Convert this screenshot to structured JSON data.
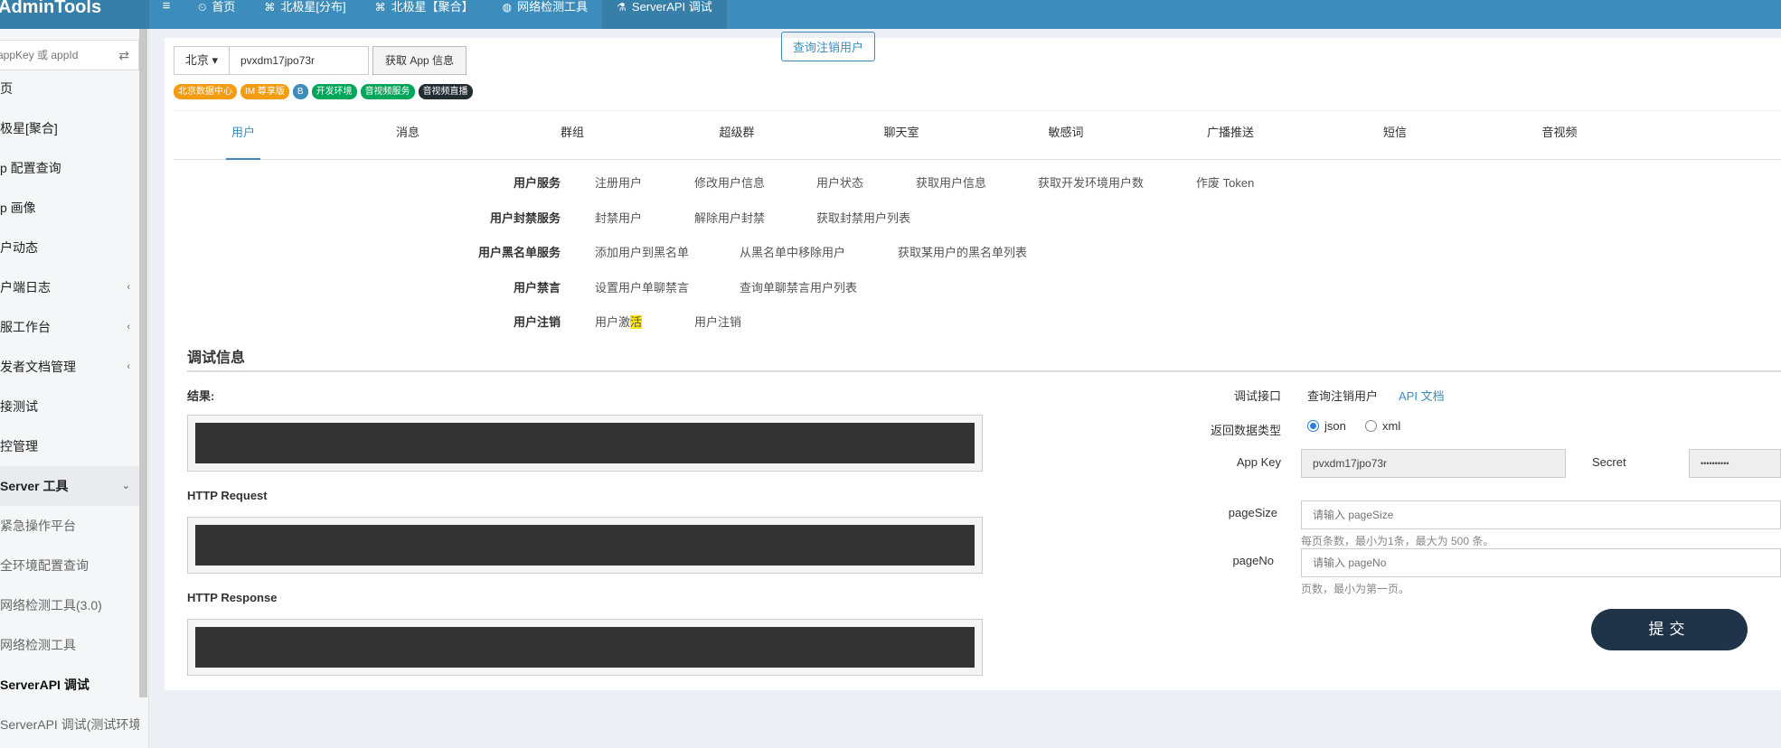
{
  "app": {
    "logo": "AdminTools"
  },
  "nav": {
    "toggle": "≡",
    "items": [
      {
        "icon": "⏲",
        "label": "首页"
      },
      {
        "icon": "⌘",
        "label": "北极星[分布]"
      },
      {
        "icon": "⌘",
        "label": "北极星【聚合】"
      },
      {
        "icon": "◍",
        "label": "网络检测工具"
      },
      {
        "icon": "⚗",
        "label": "ServerAPI 调试"
      }
    ]
  },
  "sidebar": {
    "search_placeholder": "appKey 或 appId",
    "switch_icon": "⇄",
    "items": [
      {
        "label": "页",
        "caret": "",
        "style": ""
      },
      {
        "label": "极星[聚合]",
        "caret": "",
        "style": ""
      },
      {
        "label": "p 配置查询",
        "caret": "",
        "style": ""
      },
      {
        "label": "p 画像",
        "caret": "",
        "style": ""
      },
      {
        "label": "户动态",
        "caret": "",
        "style": ""
      },
      {
        "label": "户端日志",
        "caret": "‹",
        "style": ""
      },
      {
        "label": "服工作台",
        "caret": "‹",
        "style": ""
      },
      {
        "label": "发者文档管理",
        "caret": "‹",
        "style": ""
      },
      {
        "label": "接测试",
        "caret": "",
        "style": ""
      },
      {
        "label": "控管理",
        "caret": "",
        "style": ""
      },
      {
        "label": "Server 工具",
        "caret": "⌄",
        "style": "bold"
      },
      {
        "label": "紧急操作平台",
        "caret": "",
        "style": "sub"
      },
      {
        "label": "全环境配置查询",
        "caret": "",
        "style": "sub"
      },
      {
        "label": "网络检测工具(3.0)",
        "caret": "",
        "style": "sub"
      },
      {
        "label": "网络检测工具",
        "caret": "",
        "style": "sub"
      },
      {
        "label": "ServerAPI 调试",
        "caret": "",
        "style": "sub active"
      },
      {
        "label": "ServerAPI 调试(测试环境)",
        "caret": "",
        "style": "sub"
      }
    ]
  },
  "toolbar": {
    "region": "北京 ▾",
    "appkey": "pvxdm17jpo73r",
    "fetch_label": "获取 App 信息"
  },
  "badges": [
    {
      "label": "北京数据中心",
      "color": "#f39c12"
    },
    {
      "label": "IM 尊享版",
      "color": "#f39c12"
    },
    {
      "label": "B",
      "color": "#3c8dbc"
    },
    {
      "label": "开发环境",
      "color": "#00a65a"
    },
    {
      "label": "音视频服务",
      "color": "#00a65a"
    },
    {
      "label": "音视频直播",
      "color": "#222d32"
    }
  ],
  "tabs": [
    "用户",
    "消息",
    "群组",
    "超级群",
    "聊天室",
    "敏感词",
    "广播推送",
    "短信",
    "音视频"
  ],
  "services": [
    {
      "label": "用户服务",
      "links": [
        "注册用户",
        "修改用户信息",
        "用户状态",
        "获取用户信息",
        "获取开发环境用户数",
        "作废 Token"
      ]
    },
    {
      "label": "用户封禁服务",
      "links": [
        "封禁用户",
        "解除用户封禁",
        "获取封禁用户列表"
      ]
    },
    {
      "label": "用户黑名单服务",
      "links": [
        "添加用户到黑名单",
        "从黑名单中移除用户",
        "获取某用户的黑名单列表"
      ]
    },
    {
      "label": "用户禁言",
      "links": [
        "设置用户单聊禁言",
        "查询单聊禁言用户列表"
      ]
    },
    {
      "label": "用户注销",
      "links": [
        "用户激",
        "用户注销",
        "查询注销用户"
      ],
      "highlight": "活"
    }
  ],
  "debug": {
    "title": "调试信息",
    "result_label": "结果:",
    "request_label": "HTTP Request",
    "response_label": "HTTP Response"
  },
  "form": {
    "api_label": "调试接口",
    "api_value": "查询注销用户",
    "api_doc": "API 文档",
    "type_label": "返回数据类型",
    "type_options": [
      "json",
      "xml"
    ],
    "type_selected": "json",
    "appkey_label": "App Key",
    "appkey_value": "pvxdm17jpo73r",
    "secret_label": "Secret",
    "secret_value": "••••••••••",
    "pagesize_label": "pageSize",
    "pagesize_placeholder": "请输入 pageSize",
    "pagesize_hint": "每页条数，最小为1条，最大为 500 条。",
    "pageno_label": "pageNo",
    "pageno_placeholder": "请输入 pageNo",
    "pageno_hint": "页数，最小为第一页。",
    "submit_label": "提交"
  }
}
